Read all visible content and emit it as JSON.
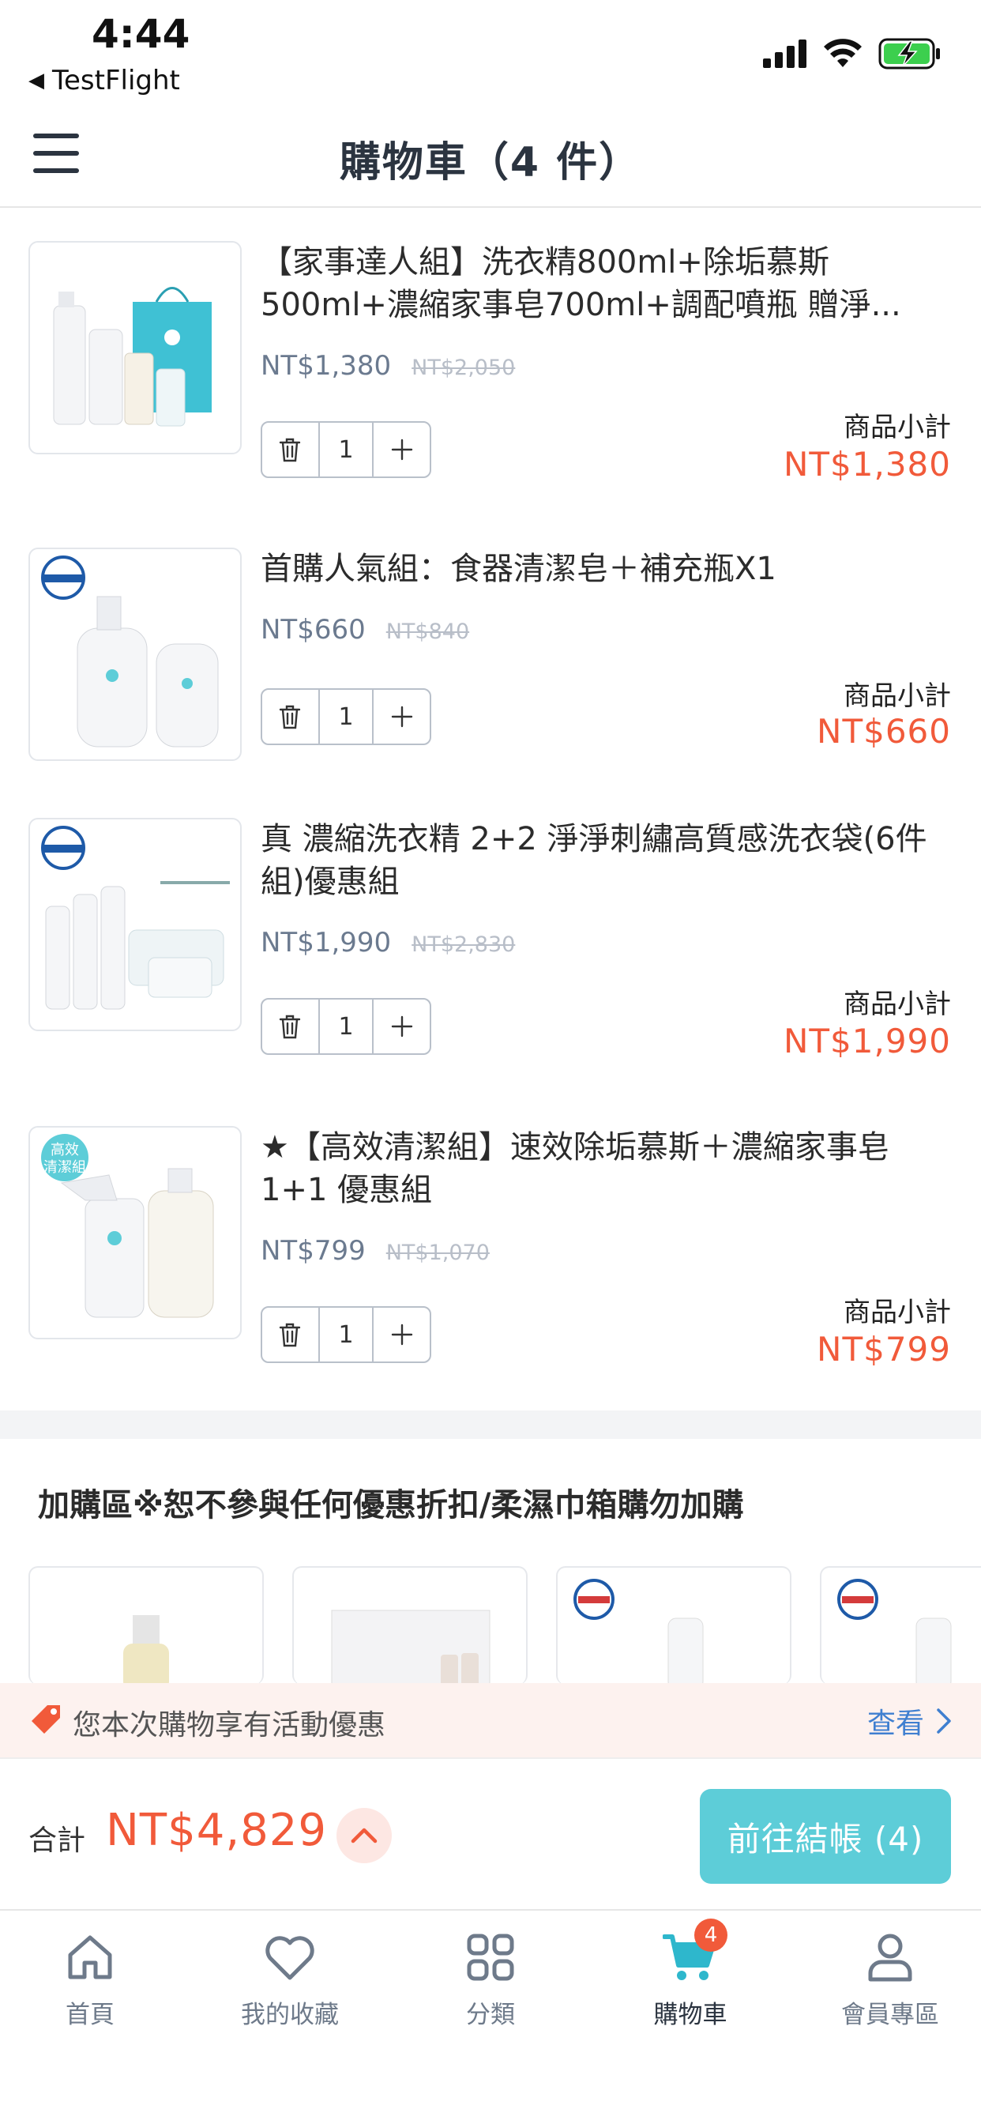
{
  "status_bar": {
    "time": "4:44",
    "back_app": "TestFlight"
  },
  "header": {
    "title": "購物車（4 件）"
  },
  "cart": {
    "items": [
      {
        "title": "【家事達人組】洗衣精800ml+除垢慕斯500ml+濃縮家事皂700ml+調配噴瓶 贈淨...",
        "price": "NT$1,380",
        "original_price": "NT$2,050",
        "quantity": "1",
        "subtotal_label": "商品小計",
        "subtotal": "NT$1,380"
      },
      {
        "title": "首購人氣組：食器清潔皂＋補充瓶X1",
        "price": "NT$660",
        "original_price": "NT$840",
        "quantity": "1",
        "subtotal_label": "商品小計",
        "subtotal": "NT$660"
      },
      {
        "title": "真 濃縮洗衣精 2+2 淨淨刺繡高質感洗衣袋(6件組)優惠組",
        "price": "NT$1,990",
        "original_price": "NT$2,830",
        "quantity": "1",
        "subtotal_label": "商品小計",
        "subtotal": "NT$1,990"
      },
      {
        "title": "★【高效清潔組】速效除垢慕斯＋濃縮家事皂1+1 優惠組",
        "price": "NT$799",
        "original_price": "NT$1,070",
        "quantity": "1",
        "subtotal_label": "商品小計",
        "subtotal": "NT$799"
      }
    ]
  },
  "addon": {
    "title": "加購區※恕不參與任何優惠折扣/柔濕巾箱購勿加購"
  },
  "promo": {
    "text": "您本次購物享有活動優惠",
    "link": "查看"
  },
  "checkout": {
    "total_label": "合計",
    "total": "NT$4,829",
    "button": "前往結帳 (4)"
  },
  "nav": {
    "items": [
      {
        "label": "首頁",
        "icon": "home-icon"
      },
      {
        "label": "我的收藏",
        "icon": "heart-icon"
      },
      {
        "label": "分類",
        "icon": "category-icon"
      },
      {
        "label": "購物車",
        "icon": "cart-icon",
        "badge": "4"
      },
      {
        "label": "會員專區",
        "icon": "user-icon"
      }
    ]
  },
  "colors": {
    "accent_price": "#f15a3a",
    "checkout_button": "#5dcdd8",
    "link_blue": "#3f7fd0",
    "promo_bg": "#fdf2ef"
  }
}
